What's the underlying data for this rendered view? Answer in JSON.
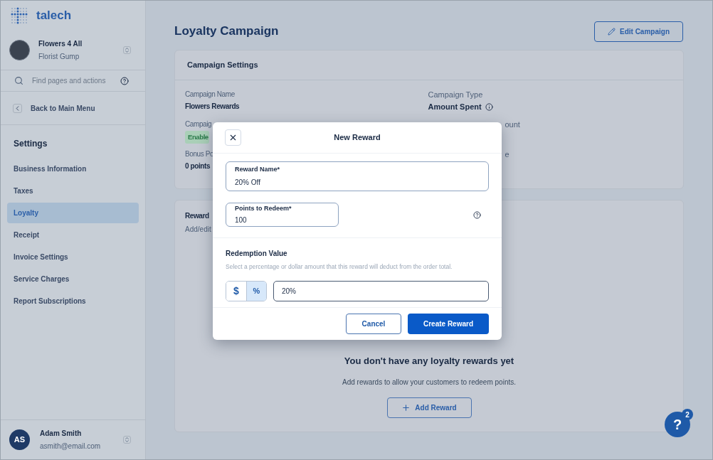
{
  "sidebar": {
    "brand": "talech",
    "account": {
      "name": "Flowers 4 All",
      "subtitle": "Florist Gump"
    },
    "search": {
      "placeholder": "Find pages and actions"
    },
    "back": "Back to Main Menu",
    "section": "Settings",
    "items": [
      {
        "label": "Business Information",
        "selected": false
      },
      {
        "label": "Taxes",
        "selected": false
      },
      {
        "label": "Loyalty",
        "selected": true
      },
      {
        "label": "Receipt",
        "selected": false
      },
      {
        "label": "Invoice Settings",
        "selected": false
      },
      {
        "label": "Service Charges",
        "selected": false
      },
      {
        "label": "Report Subscriptions",
        "selected": false
      }
    ],
    "user": {
      "initials": "AS",
      "name": "Adam Smith",
      "email": "asmith@email.com"
    }
  },
  "page": {
    "title": "Loyalty Campaign",
    "edit_button": "Edit Campaign",
    "settings": {
      "title": "Campaign Settings",
      "left": [
        {
          "kind": "text",
          "label": "Campaign Name",
          "value": "Flowers Rewards"
        },
        {
          "kind": "badge",
          "label": "Campaig",
          "value": "Enable"
        },
        {
          "kind": "text",
          "label": "Bonus Po",
          "value": "0 points"
        }
      ],
      "right": [
        {
          "kind": "info",
          "label": "Campaign Type",
          "value": "Amount Spent"
        },
        {
          "kind": "cut",
          "label": "ount"
        },
        {
          "kind": "cut",
          "label": "e"
        }
      ]
    },
    "rewards": {
      "title": "Reward",
      "subtitle": "Add/edit",
      "empty_title": "You don't have any loyalty rewards yet",
      "empty_text": "Add rewards to allow your customers to redeem points.",
      "add_button": "Add Reward"
    }
  },
  "modal": {
    "title": "New Reward",
    "reward_name": {
      "label": "Reward Name*",
      "value": "20% Off"
    },
    "points": {
      "label": "Points to Redeem*",
      "value": "100"
    },
    "redemption": {
      "title": "Redemption Value",
      "hint": "Select a percentage or dollar amount that this reward will deduct from the order total.",
      "units": [
        {
          "symbol": "$",
          "selected": false
        },
        {
          "symbol": "%",
          "selected": true
        }
      ],
      "value": "20%"
    },
    "cancel": "Cancel",
    "create": "Create Reward"
  },
  "help": {
    "symbol": "?",
    "badge": "2"
  }
}
